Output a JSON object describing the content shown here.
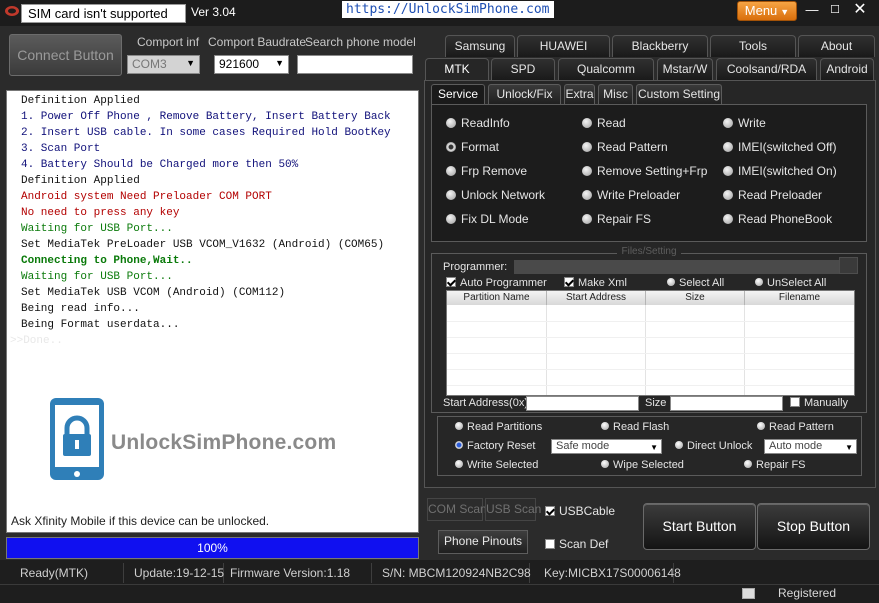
{
  "titlebar": {
    "sim_status": "SIM card isn't supported",
    "version": "Ver 3.04",
    "url": "https://UnlockSimPhone.com",
    "menu_label": "Menu",
    "minimize": "—",
    "maximize": "☐",
    "close": "✕"
  },
  "controls": {
    "connect_label": "Connect Button",
    "comport_label": "Comport inf",
    "comport_value": "COM3",
    "baud_label": "Comport Baudrate",
    "baud_value": "921600",
    "search_label": "Search phone model",
    "search_value": ""
  },
  "log": {
    "lines": [
      {
        "text": "Definition Applied",
        "color": "black"
      },
      {
        "text": "1. Power Off Phone , Remove Battery, Insert Battery Back",
        "color": "navy"
      },
      {
        "text": "2. Insert USB cable. In some cases Required Hold BootKey",
        "color": "navy"
      },
      {
        "text": "3. Scan Port",
        "color": "navy"
      },
      {
        "text": "4. Battery Should be Charged more then 50%",
        "color": "navy"
      },
      {
        "text": "Definition Applied",
        "color": "black"
      },
      {
        "text": "Android system Need Preloader COM PORT",
        "color": "red"
      },
      {
        "text": "No need to press any key",
        "color": "red"
      },
      {
        "text": "Waiting for USB Port...",
        "color": "green"
      },
      {
        "text": "Set MediaTek PreLoader USB VCOM_V1632 (Android) (COM65)",
        "color": "black"
      },
      {
        "text": "Connecting to Phone,Wait..",
        "color": "bgreen"
      },
      {
        "text": "Waiting for USB Port...",
        "color": "green"
      },
      {
        "text": "Set MediaTek USB VCOM (Android) (COM112)",
        "color": "black"
      },
      {
        "text": "Being read info...",
        "color": "black"
      },
      {
        "text": "Being Format userdata...",
        "color": "black"
      },
      {
        "text": ">>Done..",
        "color": "prompt"
      }
    ],
    "watermark_text": "UnlockSimPhone.com",
    "footer": "Ask Xfinity Mobile if this device can be unlocked."
  },
  "progress": {
    "value": 1.0,
    "label": "100%"
  },
  "brand_tabs": {
    "row1": [
      "Samsung",
      "HUAWEI",
      "Blackberry",
      "Tools",
      "About"
    ],
    "row2": [
      "MTK",
      "SPD",
      "Qualcomm",
      "Mstar/W",
      "Coolsand/RDA",
      "Android"
    ],
    "active": "MTK"
  },
  "sub_tabs": {
    "items": [
      "Service",
      "Unlock/Fix",
      "Extra",
      "Misc",
      "Custom Setting"
    ],
    "active": "Service"
  },
  "service_options": [
    [
      "ReadInfo",
      "Read",
      "Write"
    ],
    [
      "Format",
      "Read Pattern",
      "IMEI(switched Off)"
    ],
    [
      "Frp Remove",
      "Remove Setting+Frp",
      "IMEI(switched On)"
    ],
    [
      "Unlock Network",
      "Write Preloader",
      "Read Preloader"
    ],
    [
      "Fix DL Mode",
      "Repair FS",
      "Read PhoneBook"
    ]
  ],
  "service_selected": "Format",
  "files": {
    "title": "Files/Setting",
    "programmer_label": "Programmer:",
    "auto_programmer": "Auto Programmer",
    "make_xml": "Make Xml",
    "select_all": "Select All",
    "unselect_all": "UnSelect All",
    "columns": [
      "Partition Name",
      "Start Address",
      "Size",
      "Filename"
    ],
    "start_address_label": "Start Address(0x)",
    "size_label": "Size :",
    "manually": "Manually"
  },
  "advanced": {
    "read_partitions": "Read Partitions",
    "read_flash": "Read Flash",
    "read_pattern": "Read Pattern",
    "factory_reset": "Factory Reset",
    "factory_mode": "Safe mode",
    "direct_unlock": "Direct Unlock",
    "unlock_mode": "Auto mode",
    "write_selected": "Write Selected",
    "wipe_selected": "Wipe Selected",
    "repair_fs": "Repair FS"
  },
  "bottom": {
    "com_scan": "COM Scan",
    "usb_scan": "USB Scan",
    "usbcable": "USBCable",
    "phone_pinouts": "Phone Pinouts",
    "scan_def": "Scan Def",
    "start": "Start Button",
    "stop": "Stop Button"
  },
  "status": {
    "ready": "Ready(MTK)",
    "update": "Update:19-12-15",
    "firmware": "Firmware Version:1.18",
    "serial": "S/N: MBCM120924NB2C98",
    "key": "Key:MICBX17S00006148",
    "registered": "Registered"
  },
  "colors": {
    "log_black": "#111111",
    "log_navy": "#10107a",
    "log_red": "#b30000",
    "log_green": "#0a7a0a",
    "progress": "#1010f0",
    "menu": "#e98a24"
  }
}
